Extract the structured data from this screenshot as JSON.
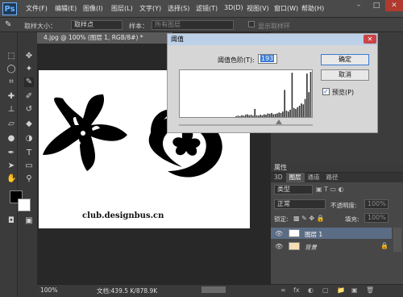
{
  "app": {
    "logo": "Ps"
  },
  "menu": [
    "文件(F)",
    "编辑(E)",
    "图像(I)",
    "图层(L)",
    "文字(Y)",
    "选择(S)",
    "滤镜(T)",
    "3D(D)",
    "视图(V)",
    "窗口(W)",
    "帮助(H)"
  ],
  "window_controls": [
    "–",
    "□",
    "✕"
  ],
  "options": {
    "sample_size_label": "取样大小：",
    "sample_size_value": "取样点",
    "sample_label": "样本：",
    "sample_value": "所有图层",
    "show_ring_label": "显示取样环"
  },
  "document": {
    "tab_title": "4.jpg @ 100% (图层 1, RGB/8#) *",
    "watermark": "club.designbus.cn",
    "zoom": "100%",
    "doc_size": "文档:439.5 K/878.9K"
  },
  "dialog": {
    "title": "阈值",
    "close": "✕",
    "threshold_label": "阈值色阶(T):",
    "threshold_value": "193",
    "ok": "确定",
    "cancel": "取消",
    "preview_label": "预览(P)",
    "preview_checked": "✓"
  },
  "panels": {
    "properties_title": "属性",
    "layer_tabs": [
      "3D",
      "图层",
      "通道",
      "路径"
    ],
    "kind_label": "类型",
    "blend_mode": "正常",
    "opacity_label": "不透明度:",
    "opacity_value": "100%",
    "lock_label": "锁定:",
    "fill_label": "填充:",
    "fill_value": "100%",
    "layers": [
      {
        "name": "图层 1"
      },
      {
        "name": "背景"
      }
    ],
    "footer_icons": [
      "fx",
      "◐",
      "▢",
      "📁",
      "▣",
      "🗑"
    ]
  },
  "colors": {
    "accent": "#3a7bd5",
    "selected_layer": "#5b6c85"
  },
  "histogram": {
    "values": [
      0,
      0,
      0,
      0,
      0,
      0,
      0,
      0,
      0,
      0,
      0,
      0,
      0,
      0,
      0,
      0,
      0,
      0,
      0,
      0,
      0,
      0,
      0,
      0,
      0,
      0,
      0,
      0,
      0,
      0,
      2,
      3,
      2,
      4,
      3,
      5,
      6,
      4,
      5,
      3,
      18,
      4,
      3,
      5,
      4,
      6,
      5,
      8,
      7,
      9,
      6,
      7,
      8,
      10,
      9,
      12,
      60,
      14,
      12,
      16,
      98,
      20,
      18,
      22,
      25,
      30,
      28,
      40,
      96,
      55,
      100
    ]
  }
}
